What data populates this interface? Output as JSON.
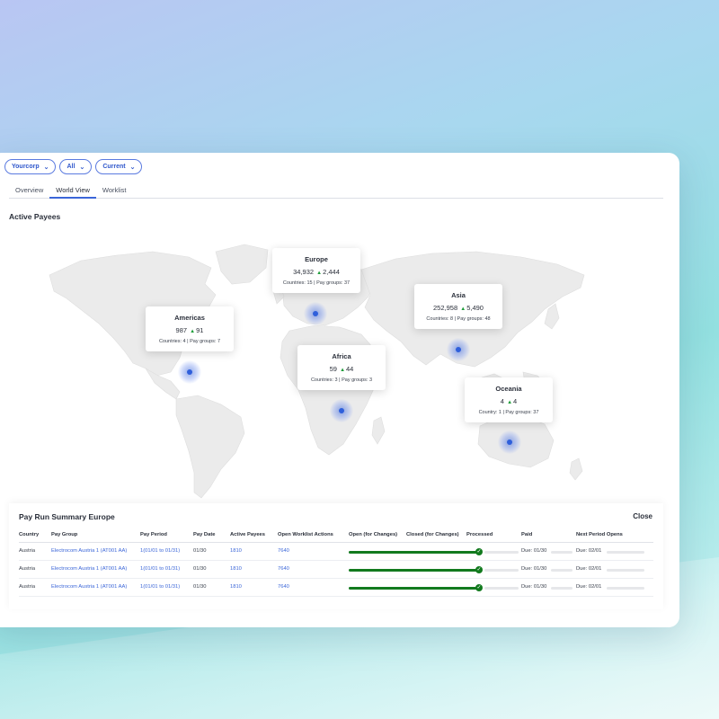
{
  "filters": [
    {
      "label": "Yourcorp"
    },
    {
      "label": "All"
    },
    {
      "label": "Current"
    }
  ],
  "tabs": [
    {
      "label": "Overview"
    },
    {
      "label": "World View",
      "active": true
    },
    {
      "label": "Worklist"
    }
  ],
  "section_title": "Active Payees",
  "regions": [
    {
      "name": "Europe",
      "value": "34,932",
      "delta": "2,444",
      "sub": "Countries: 15 | Pay groups: 37"
    },
    {
      "name": "Americas",
      "value": "987",
      "delta": "91",
      "sub": "Countries: 4 | Pay groups: 7"
    },
    {
      "name": "Asia",
      "value": "252,958",
      "delta": "5,490",
      "sub": "Countries: 8 | Pay groups: 48"
    },
    {
      "name": "Africa",
      "value": "59",
      "delta": "44",
      "sub": "Countries: 3 | Pay groups: 3"
    },
    {
      "name": "Oceania",
      "value": "4",
      "delta": "4",
      "sub": "Country: 1 | Pay groups: 37"
    }
  ],
  "summary": {
    "title": "Pay Run Summary Europe",
    "close_label": "Close",
    "headers": [
      "Country",
      "Pay Group",
      "Pay Period",
      "Pay Date",
      "Active Payees",
      "Open Worklist Actions",
      "Open (for Changes)",
      "Closed (for Changes)",
      "Processed",
      "Paid",
      "Next Period Opens"
    ],
    "rows": [
      {
        "country": "Austria",
        "pay_group": "Electrocom Austria 1 (AT001 AA)",
        "pay_period": "1(01/01 to 01/31)",
        "pay_date": "01/30",
        "active_payees": "1810",
        "worklist": "7640",
        "progress": 1.0,
        "paid": "Due: 01/30",
        "next": "Due: 02/01"
      },
      {
        "country": "Austria",
        "pay_group": "Electrocom Austria 1 (AT001 AA)",
        "pay_period": "1(01/01 to 01/31)",
        "pay_date": "01/30",
        "active_payees": "1810",
        "worklist": "7640",
        "progress": 1.0,
        "paid": "Due: 01/30",
        "next": "Due: 02/01"
      },
      {
        "country": "Austria",
        "pay_group": "Electrocom Austria 1 (AT001 AA)",
        "pay_period": "1(01/01 to 01/31)",
        "pay_date": "01/30",
        "active_payees": "1810",
        "worklist": "7640",
        "progress": 1.0,
        "paid": "Due: 01/30",
        "next": "Due: 02/01"
      }
    ]
  },
  "colors": {
    "accent": "#3b66d8",
    "positive": "#1f9d3a",
    "progress": "#127a1e"
  }
}
